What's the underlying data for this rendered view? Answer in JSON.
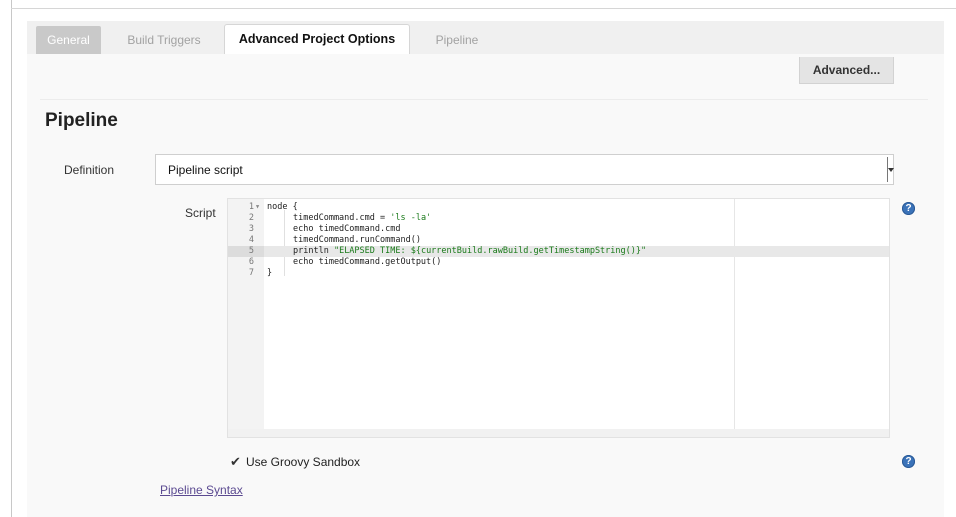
{
  "tabs": [
    {
      "label": "General"
    },
    {
      "label": "Build Triggers"
    },
    {
      "label": "Advanced Project Options"
    },
    {
      "label": "Pipeline"
    }
  ],
  "advanced_button": "Advanced...",
  "section_title": "Pipeline",
  "definition": {
    "label": "Definition",
    "selected": "Pipeline script"
  },
  "script": {
    "label": "Script",
    "active_line": 5,
    "lines": [
      {
        "num": "1",
        "fold": "▾",
        "text": "node {"
      },
      {
        "num": "2",
        "fold": "",
        "text": "timedCommand.cmd = 'ls -la'"
      },
      {
        "num": "3",
        "fold": "",
        "text": "echo timedCommand.cmd"
      },
      {
        "num": "4",
        "fold": "",
        "text": "timedCommand.runCommand()"
      },
      {
        "num": "5",
        "fold": "",
        "text": "println \"ELAPSED TIME: ${currentBuild.rawBuild.getTimestampString()}\""
      },
      {
        "num": "6",
        "fold": "",
        "text": "echo timedCommand.getOutput()"
      },
      {
        "num": "7",
        "fold": "",
        "text": "}"
      }
    ]
  },
  "sandbox": {
    "label": "Use Groovy Sandbox",
    "checked": true,
    "check_glyph": "✔"
  },
  "help_glyph": "?",
  "syntax_link": "Pipeline Syntax",
  "icons": [
    "help-icon",
    "checkbox-check-icon",
    "dropdown-arrow-icon",
    "fold-arrow-icon"
  ],
  "colors": {
    "active_tab_text": "#111111",
    "general_tab_bg": "#c9c9c9",
    "help_icon": "#3b73b9",
    "link": "#5b4a91",
    "string_literal": "#1a7a1a"
  }
}
